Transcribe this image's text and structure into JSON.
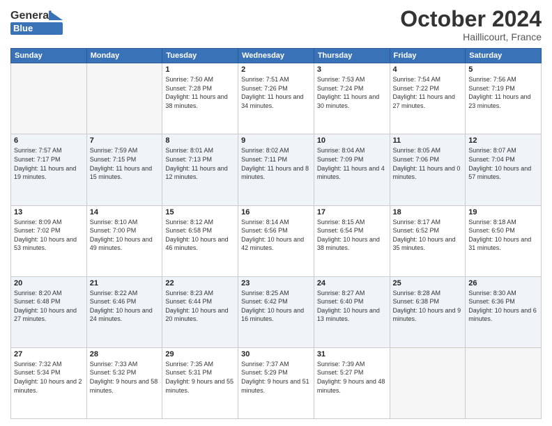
{
  "header": {
    "logo_line1": "General",
    "logo_line2": "Blue",
    "month": "October 2024",
    "location": "Haillicourt, France"
  },
  "days_of_week": [
    "Sunday",
    "Monday",
    "Tuesday",
    "Wednesday",
    "Thursday",
    "Friday",
    "Saturday"
  ],
  "weeks": [
    [
      {
        "day": "",
        "sunrise": "",
        "sunset": "",
        "daylight": "",
        "empty": true
      },
      {
        "day": "",
        "sunrise": "",
        "sunset": "",
        "daylight": "",
        "empty": true
      },
      {
        "day": "1",
        "sunrise": "Sunrise: 7:50 AM",
        "sunset": "Sunset: 7:28 PM",
        "daylight": "Daylight: 11 hours and 38 minutes."
      },
      {
        "day": "2",
        "sunrise": "Sunrise: 7:51 AM",
        "sunset": "Sunset: 7:26 PM",
        "daylight": "Daylight: 11 hours and 34 minutes."
      },
      {
        "day": "3",
        "sunrise": "Sunrise: 7:53 AM",
        "sunset": "Sunset: 7:24 PM",
        "daylight": "Daylight: 11 hours and 30 minutes."
      },
      {
        "day": "4",
        "sunrise": "Sunrise: 7:54 AM",
        "sunset": "Sunset: 7:22 PM",
        "daylight": "Daylight: 11 hours and 27 minutes."
      },
      {
        "day": "5",
        "sunrise": "Sunrise: 7:56 AM",
        "sunset": "Sunset: 7:19 PM",
        "daylight": "Daylight: 11 hours and 23 minutes."
      }
    ],
    [
      {
        "day": "6",
        "sunrise": "Sunrise: 7:57 AM",
        "sunset": "Sunset: 7:17 PM",
        "daylight": "Daylight: 11 hours and 19 minutes."
      },
      {
        "day": "7",
        "sunrise": "Sunrise: 7:59 AM",
        "sunset": "Sunset: 7:15 PM",
        "daylight": "Daylight: 11 hours and 15 minutes."
      },
      {
        "day": "8",
        "sunrise": "Sunrise: 8:01 AM",
        "sunset": "Sunset: 7:13 PM",
        "daylight": "Daylight: 11 hours and 12 minutes."
      },
      {
        "day": "9",
        "sunrise": "Sunrise: 8:02 AM",
        "sunset": "Sunset: 7:11 PM",
        "daylight": "Daylight: 11 hours and 8 minutes."
      },
      {
        "day": "10",
        "sunrise": "Sunrise: 8:04 AM",
        "sunset": "Sunset: 7:09 PM",
        "daylight": "Daylight: 11 hours and 4 minutes."
      },
      {
        "day": "11",
        "sunrise": "Sunrise: 8:05 AM",
        "sunset": "Sunset: 7:06 PM",
        "daylight": "Daylight: 11 hours and 0 minutes."
      },
      {
        "day": "12",
        "sunrise": "Sunrise: 8:07 AM",
        "sunset": "Sunset: 7:04 PM",
        "daylight": "Daylight: 10 hours and 57 minutes."
      }
    ],
    [
      {
        "day": "13",
        "sunrise": "Sunrise: 8:09 AM",
        "sunset": "Sunset: 7:02 PM",
        "daylight": "Daylight: 10 hours and 53 minutes."
      },
      {
        "day": "14",
        "sunrise": "Sunrise: 8:10 AM",
        "sunset": "Sunset: 7:00 PM",
        "daylight": "Daylight: 10 hours and 49 minutes."
      },
      {
        "day": "15",
        "sunrise": "Sunrise: 8:12 AM",
        "sunset": "Sunset: 6:58 PM",
        "daylight": "Daylight: 10 hours and 46 minutes."
      },
      {
        "day": "16",
        "sunrise": "Sunrise: 8:14 AM",
        "sunset": "Sunset: 6:56 PM",
        "daylight": "Daylight: 10 hours and 42 minutes."
      },
      {
        "day": "17",
        "sunrise": "Sunrise: 8:15 AM",
        "sunset": "Sunset: 6:54 PM",
        "daylight": "Daylight: 10 hours and 38 minutes."
      },
      {
        "day": "18",
        "sunrise": "Sunrise: 8:17 AM",
        "sunset": "Sunset: 6:52 PM",
        "daylight": "Daylight: 10 hours and 35 minutes."
      },
      {
        "day": "19",
        "sunrise": "Sunrise: 8:18 AM",
        "sunset": "Sunset: 6:50 PM",
        "daylight": "Daylight: 10 hours and 31 minutes."
      }
    ],
    [
      {
        "day": "20",
        "sunrise": "Sunrise: 8:20 AM",
        "sunset": "Sunset: 6:48 PM",
        "daylight": "Daylight: 10 hours and 27 minutes."
      },
      {
        "day": "21",
        "sunrise": "Sunrise: 8:22 AM",
        "sunset": "Sunset: 6:46 PM",
        "daylight": "Daylight: 10 hours and 24 minutes."
      },
      {
        "day": "22",
        "sunrise": "Sunrise: 8:23 AM",
        "sunset": "Sunset: 6:44 PM",
        "daylight": "Daylight: 10 hours and 20 minutes."
      },
      {
        "day": "23",
        "sunrise": "Sunrise: 8:25 AM",
        "sunset": "Sunset: 6:42 PM",
        "daylight": "Daylight: 10 hours and 16 minutes."
      },
      {
        "day": "24",
        "sunrise": "Sunrise: 8:27 AM",
        "sunset": "Sunset: 6:40 PM",
        "daylight": "Daylight: 10 hours and 13 minutes."
      },
      {
        "day": "25",
        "sunrise": "Sunrise: 8:28 AM",
        "sunset": "Sunset: 6:38 PM",
        "daylight": "Daylight: 10 hours and 9 minutes."
      },
      {
        "day": "26",
        "sunrise": "Sunrise: 8:30 AM",
        "sunset": "Sunset: 6:36 PM",
        "daylight": "Daylight: 10 hours and 6 minutes."
      }
    ],
    [
      {
        "day": "27",
        "sunrise": "Sunrise: 7:32 AM",
        "sunset": "Sunset: 5:34 PM",
        "daylight": "Daylight: 10 hours and 2 minutes."
      },
      {
        "day": "28",
        "sunrise": "Sunrise: 7:33 AM",
        "sunset": "Sunset: 5:32 PM",
        "daylight": "Daylight: 9 hours and 58 minutes."
      },
      {
        "day": "29",
        "sunrise": "Sunrise: 7:35 AM",
        "sunset": "Sunset: 5:31 PM",
        "daylight": "Daylight: 9 hours and 55 minutes."
      },
      {
        "day": "30",
        "sunrise": "Sunrise: 7:37 AM",
        "sunset": "Sunset: 5:29 PM",
        "daylight": "Daylight: 9 hours and 51 minutes."
      },
      {
        "day": "31",
        "sunrise": "Sunrise: 7:39 AM",
        "sunset": "Sunset: 5:27 PM",
        "daylight": "Daylight: 9 hours and 48 minutes."
      },
      {
        "day": "",
        "sunrise": "",
        "sunset": "",
        "daylight": "",
        "empty": true
      },
      {
        "day": "",
        "sunrise": "",
        "sunset": "",
        "daylight": "",
        "empty": true
      }
    ]
  ]
}
